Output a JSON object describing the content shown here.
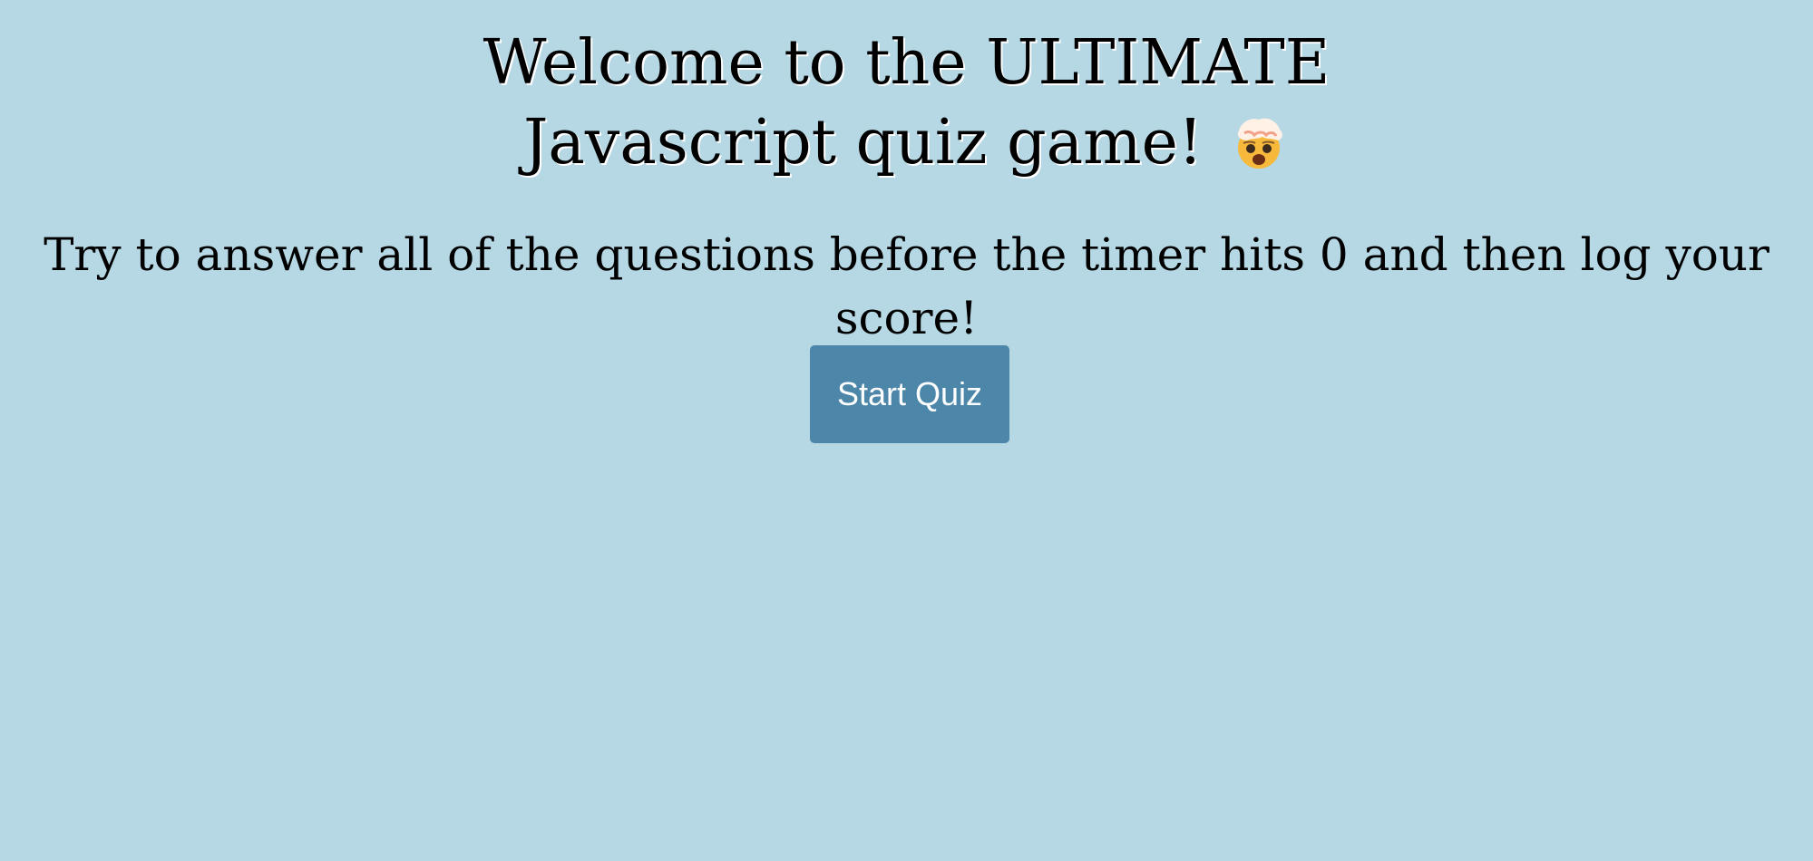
{
  "page": {
    "background_color": "#b5d8e4"
  },
  "hero": {
    "title_line_1": "Welcome to the ULTIMATE",
    "title_line_2": "Javascript quiz game!",
    "title_emoji": "exploding-head-icon",
    "subtitle": "Try to answer all of the questions before the timer hits 0 and then log your score!"
  },
  "actions": {
    "start_label": "Start Quiz",
    "start_color": "#4c86a8"
  }
}
